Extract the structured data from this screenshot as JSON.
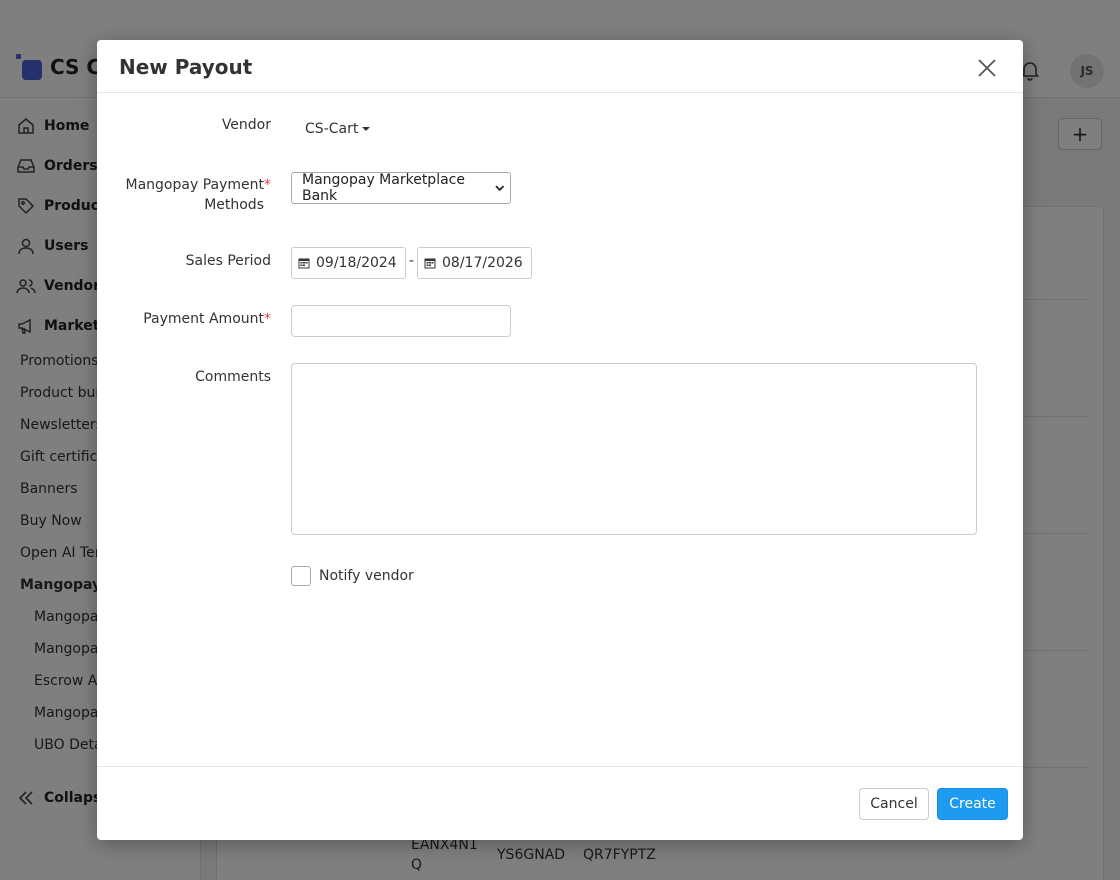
{
  "app": {
    "logo_text": "CS C",
    "avatar_initials": "JS"
  },
  "sidebar": {
    "main_items": [
      {
        "label": "Home",
        "icon": "home-icon"
      },
      {
        "label": "Orders",
        "icon": "inbox-icon"
      },
      {
        "label": "Product",
        "icon": "tag-icon"
      },
      {
        "label": "Users",
        "icon": "user-icon"
      },
      {
        "label": "Vendors",
        "icon": "users-icon"
      },
      {
        "label": "Marketi",
        "icon": "megaphone-icon"
      }
    ],
    "marketing_items": [
      "Promotions",
      "Product bun",
      "Newsletters",
      "Gift certifica",
      "Banners",
      "Buy Now",
      "Open AI Tem"
    ],
    "mangopay_header": "Mangopay M",
    "mangopay_items": [
      "Mangopay",
      "Mangopay",
      "Escrow Acc",
      "Mangopay",
      "UBO Deta"
    ],
    "collapse_label": "Collapse"
  },
  "background": {
    "plus_label": "+",
    "cells": [
      {
        "text": "EANX4N1\nQ"
      },
      {
        "text": "YS6GNAD"
      },
      {
        "text": "QR7FYPTZ"
      }
    ]
  },
  "modal": {
    "title": "New Payout",
    "vendor_label": "Vendor",
    "vendor_value": "CS-Cart",
    "payment_methods_label_line1": "Mangopay Payment",
    "payment_methods_label_line2": "Methods",
    "payment_methods_required": "*",
    "payment_methods_value": "Mangopay Marketplace Bank",
    "sales_period_label": "Sales Period",
    "date_from": "09/18/2024",
    "date_separator": "-",
    "date_to": "08/17/2026",
    "payment_amount_label": "Payment Amount",
    "payment_amount_required": "*",
    "payment_amount_value": "",
    "comments_label": "Comments",
    "comments_value": "",
    "notify_label": "Notify vendor",
    "notify_checked": false,
    "cancel_label": "Cancel",
    "create_label": "Create"
  },
  "colors": {
    "primary": "#1d9bf0",
    "required": "#e0413e",
    "logo": "#4a63d8"
  }
}
